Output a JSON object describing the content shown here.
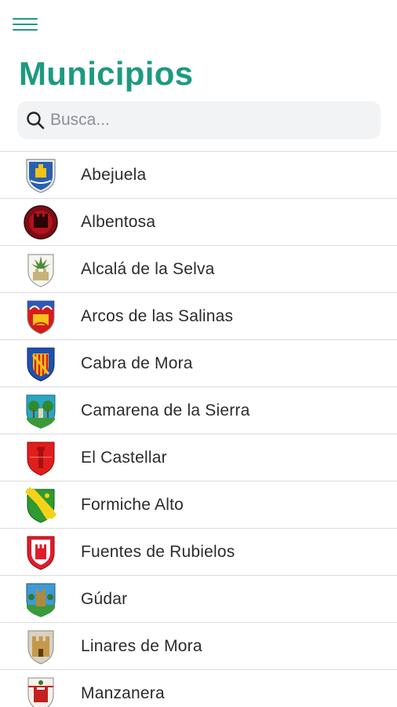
{
  "header": {
    "title": "Municipios",
    "menu_icon": "hamburger-menu-icon",
    "accent": "#1d9a80"
  },
  "search": {
    "placeholder": "Busca...",
    "value": "",
    "icon": "search-icon"
  },
  "municipalities": [
    {
      "name": "Abejuela",
      "icon": "abejuela-crest-icon"
    },
    {
      "name": "Albentosa",
      "icon": "albentosa-crest-icon"
    },
    {
      "name": "Alcalá de la Selva",
      "icon": "alcala-de-la-selva-crest-icon"
    },
    {
      "name": "Arcos de las Salinas",
      "icon": "arcos-de-las-salinas-crest-icon"
    },
    {
      "name": "Cabra de Mora",
      "icon": "cabra-de-mora-crest-icon"
    },
    {
      "name": "Camarena de la Sierra",
      "icon": "camarena-de-la-sierra-crest-icon"
    },
    {
      "name": "El Castellar",
      "icon": "el-castellar-crest-icon"
    },
    {
      "name": "Formiche Alto",
      "icon": "formiche-alto-crest-icon"
    },
    {
      "name": "Fuentes de Rubielos",
      "icon": "fuentes-de-rubielos-crest-icon"
    },
    {
      "name": "Gúdar",
      "icon": "gudar-crest-icon"
    },
    {
      "name": "Linares de Mora",
      "icon": "linares-de-mora-crest-icon"
    },
    {
      "name": "Manzanera",
      "icon": "manzanera-crest-icon"
    }
  ]
}
